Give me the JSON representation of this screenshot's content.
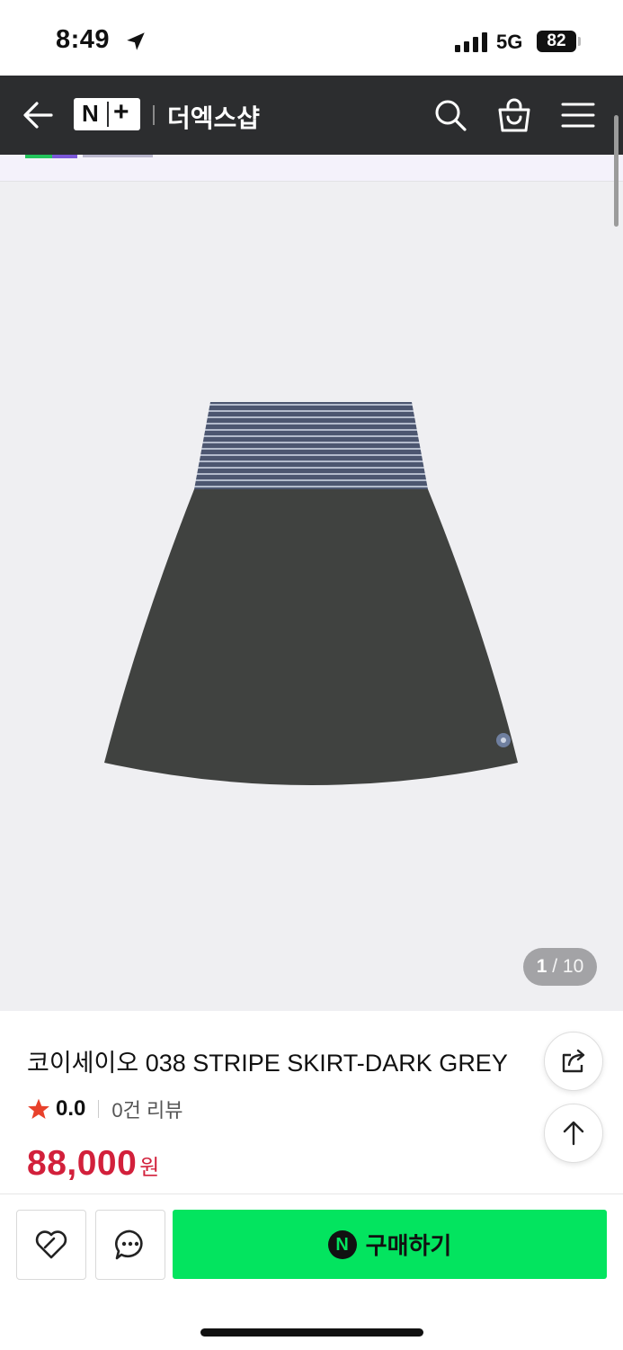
{
  "status_bar": {
    "time": "8:49",
    "network": "5G",
    "battery": "82"
  },
  "header": {
    "brand": "N+",
    "shop_name": "더엑스샵"
  },
  "gallery": {
    "current": "1",
    "total": "/ 10"
  },
  "product": {
    "title": "코이세이오 038 STRIPE SKIRT-DARK GREY",
    "rating": "0.0",
    "review_count": "0건 리뷰",
    "price": "88,000",
    "currency": "원"
  },
  "actions": {
    "buy_label": "구매하기",
    "npay_mark": "N"
  },
  "colors": {
    "header_bg": "#2c2d2f",
    "price": "#d2203b",
    "buy_button": "#03e45f",
    "star": "#e8412b"
  },
  "icons": [
    "back-arrow-icon",
    "search-icon",
    "shopping-bag-icon",
    "menu-icon",
    "share-icon",
    "arrow-up-icon",
    "heart-icon",
    "chat-icon",
    "star-icon"
  ]
}
